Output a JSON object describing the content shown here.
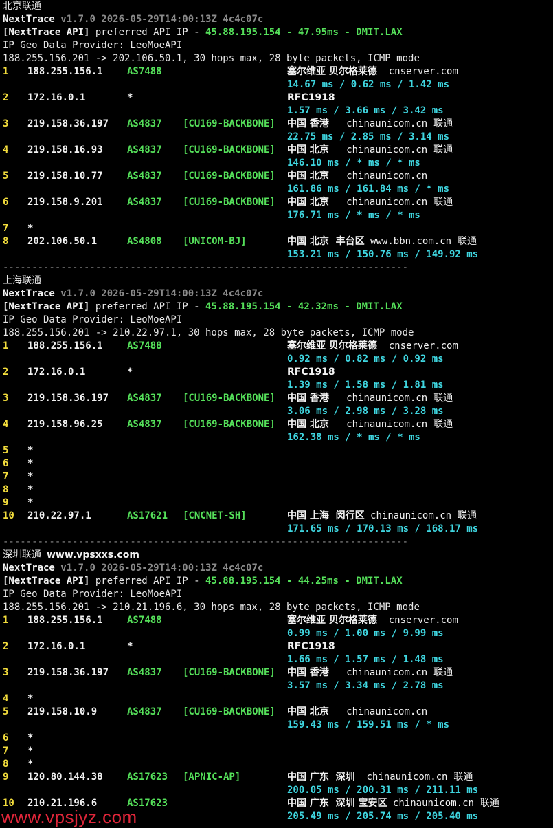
{
  "watermark": "www.vpsjyz.com",
  "sections": [
    {
      "title": "北京联通",
      "site": "",
      "app": "NextTrace",
      "version": "v1.7.0 2026-05-29T14:00:13Z 4c4c07c",
      "api_label": "[NextTrace API]",
      "api_text": " preferred API IP - ",
      "api_ip": "45.88.195.154",
      "api_dash1": " - ",
      "api_ms": "47.95ms",
      "api_dash2": " - ",
      "api_node": "DMIT.LAX",
      "geo_provider": "IP Geo Data Provider: LeoMoeAPI",
      "route": "188.255.156.201 -> 202.106.50.1, 30 hops max, 28 byte packets, ICMP mode",
      "hops": [
        {
          "no": "1",
          "ip": "188.255.156.1",
          "asn": "AS7488",
          "tag": "",
          "geo": "塞尔维亚 贝尔格莱德",
          "host": "  cnserver.com",
          "isp": "",
          "rtt": "14.67 ms / 0.62 ms / 1.42 ms"
        },
        {
          "no": "2",
          "ip": "172.16.0.1",
          "asn": "*",
          "tag": "",
          "geo": "RFC1918",
          "host": "",
          "isp": "",
          "rtt": "1.57 ms / 3.66 ms / 3.42 ms"
        },
        {
          "no": "3",
          "ip": "219.158.36.197",
          "asn": "AS4837",
          "tag": "[CU169-BACKBONE]",
          "geo": "中国 香港",
          "host": "   chinaunicom.cn",
          "isp": "  联通",
          "rtt": "22.75 ms / 2.85 ms / 3.14 ms"
        },
        {
          "no": "4",
          "ip": "219.158.16.93",
          "asn": "AS4837",
          "tag": "[CU169-BACKBONE]",
          "geo": "中国 北京",
          "host": "   chinaunicom.cn",
          "isp": "  联通",
          "rtt": "146.10 ms / * ms / * ms"
        },
        {
          "no": "5",
          "ip": "219.158.10.77",
          "asn": "AS4837",
          "tag": "[CU169-BACKBONE]",
          "geo": "中国 北京",
          "host": "   chinaunicom.cn",
          "isp": "",
          "rtt": "161.86 ms / 161.84 ms / * ms"
        },
        {
          "no": "6",
          "ip": "219.158.9.201",
          "asn": "AS4837",
          "tag": "[CU169-BACKBONE]",
          "geo": "中国 北京",
          "host": "   chinaunicom.cn",
          "isp": "  联通",
          "rtt": "176.71 ms / * ms / * ms"
        },
        {
          "no": "7",
          "ip": "*",
          "asn": "",
          "tag": "",
          "geo": "",
          "host": "",
          "isp": "",
          "rtt": ""
        },
        {
          "no": "8",
          "ip": "202.106.50.1",
          "asn": "AS4808",
          "tag": "[UNICOM-BJ]",
          "geo": "中国 北京  丰台区",
          "host": " www.bbn.com.cn",
          "isp": "  联通",
          "rtt": "153.21 ms / 150.76 ms / 149.92 ms"
        }
      ],
      "separator": "----------------------------------------------------------------------"
    },
    {
      "title": "上海联通",
      "site": "",
      "app": "NextTrace",
      "version": "v1.7.0 2026-05-29T14:00:13Z 4c4c07c",
      "api_label": "[NextTrace API]",
      "api_text": " preferred API IP - ",
      "api_ip": "45.88.195.154",
      "api_dash1": " - ",
      "api_ms": "42.32ms",
      "api_dash2": " - ",
      "api_node": "DMIT.LAX",
      "geo_provider": "IP Geo Data Provider: LeoMoeAPI",
      "route": "188.255.156.201 -> 210.22.97.1, 30 hops max, 28 byte packets, ICMP mode",
      "hops": [
        {
          "no": "1",
          "ip": "188.255.156.1",
          "asn": "AS7488",
          "tag": "",
          "geo": "塞尔维亚 贝尔格莱德",
          "host": "  cnserver.com",
          "isp": "",
          "rtt": "0.92 ms / 0.82 ms / 0.92 ms"
        },
        {
          "no": "2",
          "ip": "172.16.0.1",
          "asn": "*",
          "tag": "",
          "geo": "RFC1918",
          "host": "",
          "isp": "",
          "rtt": "1.39 ms / 1.58 ms / 1.81 ms"
        },
        {
          "no": "3",
          "ip": "219.158.36.197",
          "asn": "AS4837",
          "tag": "[CU169-BACKBONE]",
          "geo": "中国 香港",
          "host": "   chinaunicom.cn",
          "isp": "  联通",
          "rtt": "3.06 ms / 2.98 ms / 3.28 ms"
        },
        {
          "no": "4",
          "ip": "219.158.96.25",
          "asn": "AS4837",
          "tag": "[CU169-BACKBONE]",
          "geo": "中国 北京",
          "host": "   chinaunicom.cn",
          "isp": "  联通",
          "rtt": "162.38 ms / * ms / * ms"
        },
        {
          "no": "5",
          "ip": "*",
          "asn": "",
          "tag": "",
          "geo": "",
          "host": "",
          "isp": "",
          "rtt": ""
        },
        {
          "no": "6",
          "ip": "*",
          "asn": "",
          "tag": "",
          "geo": "",
          "host": "",
          "isp": "",
          "rtt": ""
        },
        {
          "no": "7",
          "ip": "*",
          "asn": "",
          "tag": "",
          "geo": "",
          "host": "",
          "isp": "",
          "rtt": ""
        },
        {
          "no": "8",
          "ip": "*",
          "asn": "",
          "tag": "",
          "geo": "",
          "host": "",
          "isp": "",
          "rtt": ""
        },
        {
          "no": "9",
          "ip": "*",
          "asn": "",
          "tag": "",
          "geo": "",
          "host": "",
          "isp": "",
          "rtt": ""
        },
        {
          "no": "10",
          "ip": "210.22.97.1",
          "asn": "AS17621",
          "tag": "[CNCNET-SH]",
          "geo": "中国 上海  闵行区",
          "host": " chinaunicom.cn",
          "isp": "  联通",
          "rtt": "171.65 ms / 170.13 ms / 168.17 ms"
        }
      ],
      "separator": "----------------------------------------------------------------------"
    },
    {
      "title": "深圳联通",
      "site": "www.vpsxxs.com",
      "app": "NextTrace",
      "version": "v1.7.0 2026-05-29T14:00:13Z 4c4c07c",
      "api_label": "[NextTrace API]",
      "api_text": " preferred API IP - ",
      "api_ip": "45.88.195.154",
      "api_dash1": " - ",
      "api_ms": "44.25ms",
      "api_dash2": " - ",
      "api_node": "DMIT.LAX",
      "geo_provider": "IP Geo Data Provider: LeoMoeAPI",
      "route": "188.255.156.201 -> 210.21.196.6, 30 hops max, 28 byte packets, ICMP mode",
      "hops": [
        {
          "no": "1",
          "ip": "188.255.156.1",
          "asn": "AS7488",
          "tag": "",
          "geo": "塞尔维亚 贝尔格莱德",
          "host": "  cnserver.com",
          "isp": "",
          "rtt": "0.99 ms / 1.00 ms / 9.99 ms"
        },
        {
          "no": "2",
          "ip": "172.16.0.1",
          "asn": "*",
          "tag": "",
          "geo": "RFC1918",
          "host": "",
          "isp": "",
          "rtt": "1.66 ms / 1.57 ms / 1.48 ms"
        },
        {
          "no": "3",
          "ip": "219.158.36.197",
          "asn": "AS4837",
          "tag": "[CU169-BACKBONE]",
          "geo": "中国 香港",
          "host": "   chinaunicom.cn",
          "isp": "  联通",
          "rtt": "3.57 ms / 3.34 ms / 2.78 ms"
        },
        {
          "no": "4",
          "ip": "*",
          "asn": "",
          "tag": "",
          "geo": "",
          "host": "",
          "isp": "",
          "rtt": ""
        },
        {
          "no": "5",
          "ip": "219.158.10.9",
          "asn": "AS4837",
          "tag": "[CU169-BACKBONE]",
          "geo": "中国 北京",
          "host": "   chinaunicom.cn",
          "isp": "",
          "rtt": "159.43 ms / 159.51 ms / * ms"
        },
        {
          "no": "6",
          "ip": "*",
          "asn": "",
          "tag": "",
          "geo": "",
          "host": "",
          "isp": "",
          "rtt": ""
        },
        {
          "no": "7",
          "ip": "*",
          "asn": "",
          "tag": "",
          "geo": "",
          "host": "",
          "isp": "",
          "rtt": ""
        },
        {
          "no": "8",
          "ip": "*",
          "asn": "",
          "tag": "",
          "geo": "",
          "host": "",
          "isp": "",
          "rtt": ""
        },
        {
          "no": "9",
          "ip": "120.80.144.38",
          "asn": "AS17623",
          "tag": "[APNIC-AP]",
          "geo": "中国 广东  深圳",
          "host": "  chinaunicom.cn",
          "isp": "  联通",
          "rtt": "200.05 ms / 200.31 ms / 211.11 ms"
        },
        {
          "no": "10",
          "ip": "210.21.196.6",
          "asn": "AS17623",
          "tag": "",
          "geo": "中国 广东  深圳 宝安区",
          "host": " chinaunicom.cn",
          "isp": "  联通",
          "rtt": "205.49 ms / 205.74 ms / 205.40 ms"
        }
      ],
      "separator": ""
    }
  ]
}
